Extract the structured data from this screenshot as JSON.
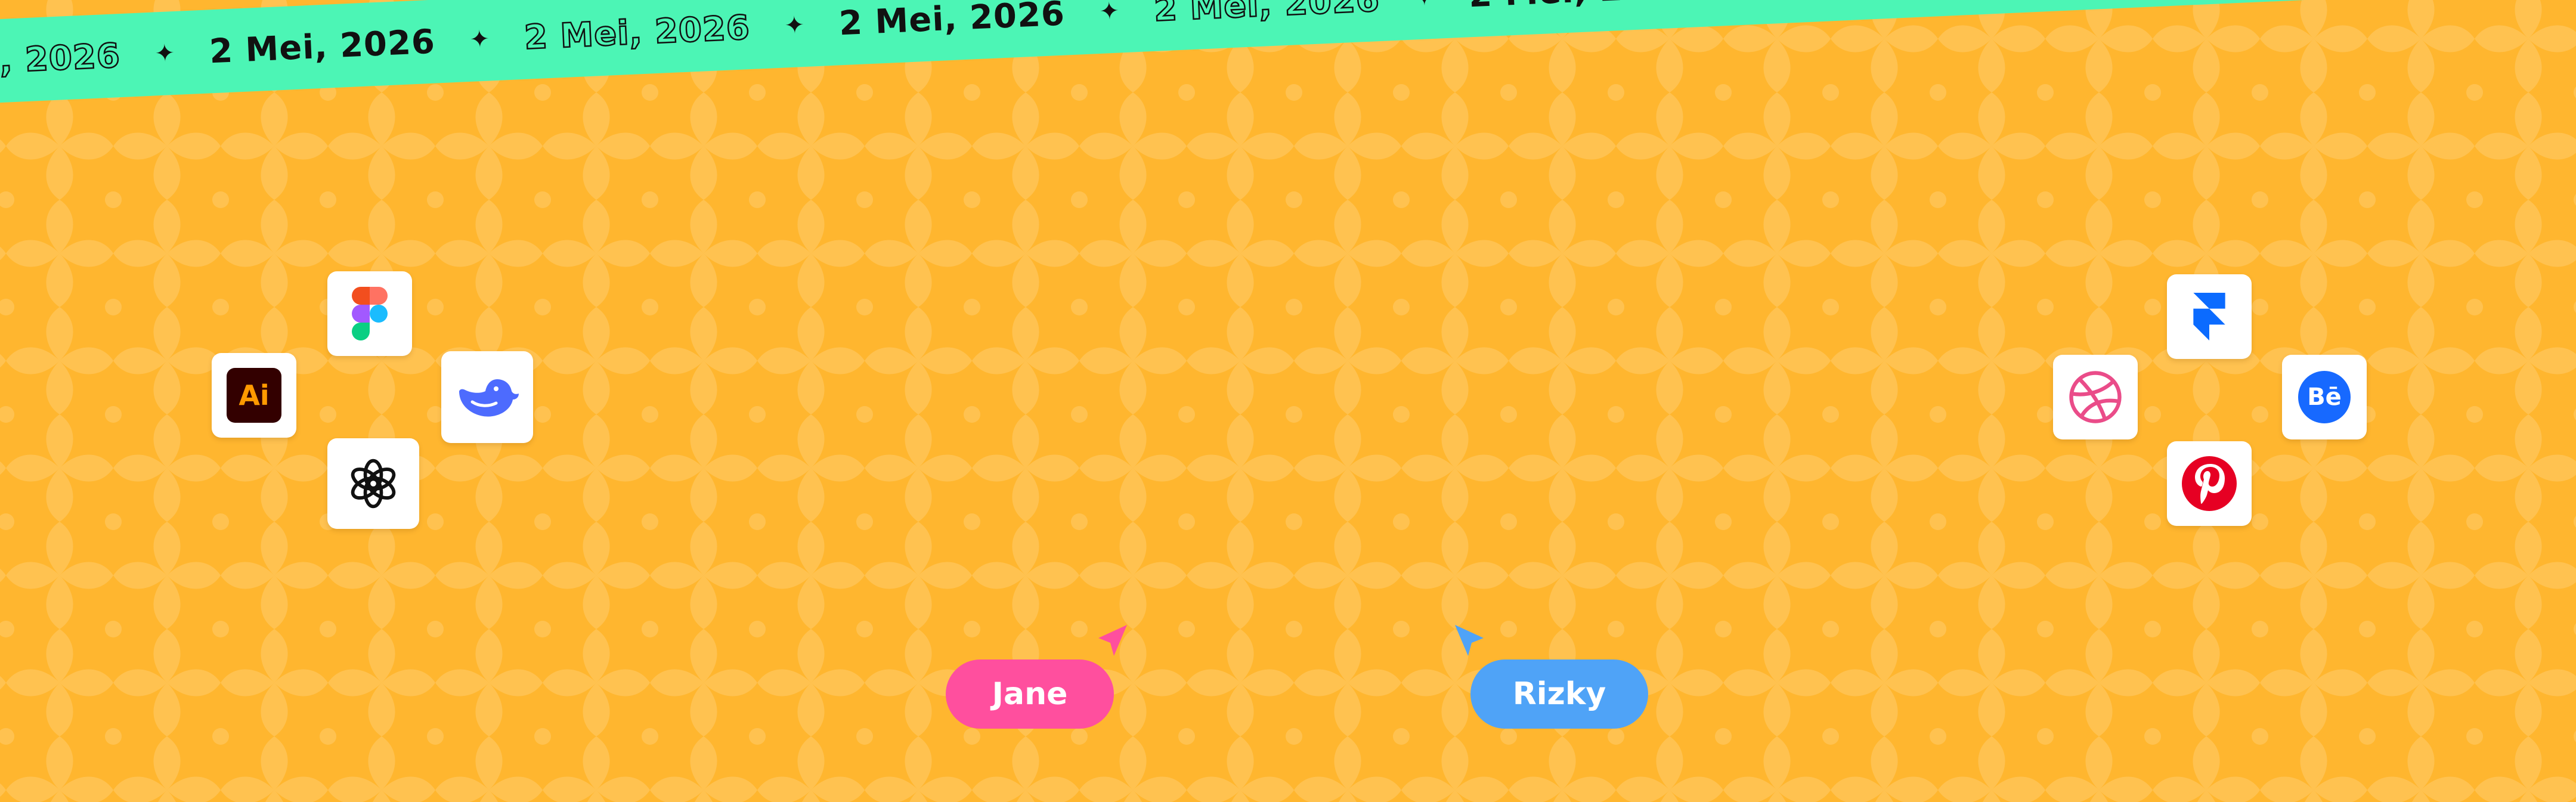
{
  "ribbon": {
    "items": [
      {
        "text": "2 Mei, 2026",
        "style": "outline"
      },
      {
        "text": "2 Mei, 2026",
        "style": "solid"
      },
      {
        "text": "2 Mei, 2026",
        "style": "outline"
      },
      {
        "text": "2 Mei, 2026",
        "style": "solid"
      },
      {
        "text": "2 Mei, 2026",
        "style": "outline"
      },
      {
        "text": "2 Mei, 2026",
        "style": "solid"
      },
      {
        "text": "2 Mei, 2026",
        "style": "outline"
      },
      {
        "text": "2 Mei, 2026",
        "style": "solid"
      },
      {
        "text": "2 Mei, 2026",
        "style": "outline"
      }
    ],
    "separator": "✦",
    "color": "#4CF5B5"
  },
  "background": {
    "color": "#FFB62F",
    "pattern": "quatrefoil-petals"
  },
  "left_cluster": {
    "icons": [
      {
        "name": "figma-icon"
      },
      {
        "name": "illustrator-icon",
        "label": "Ai"
      },
      {
        "name": "deepseek-icon"
      },
      {
        "name": "chatgpt-icon"
      }
    ]
  },
  "right_cluster": {
    "icons": [
      {
        "name": "framer-icon"
      },
      {
        "name": "dribbble-icon"
      },
      {
        "name": "behance-icon",
        "label": "Bē"
      },
      {
        "name": "pinterest-icon"
      }
    ]
  },
  "cursors": [
    {
      "name": "Jane",
      "color": "#FF4F9E"
    },
    {
      "name": "Rizky",
      "color": "#4FA3F7"
    }
  ]
}
